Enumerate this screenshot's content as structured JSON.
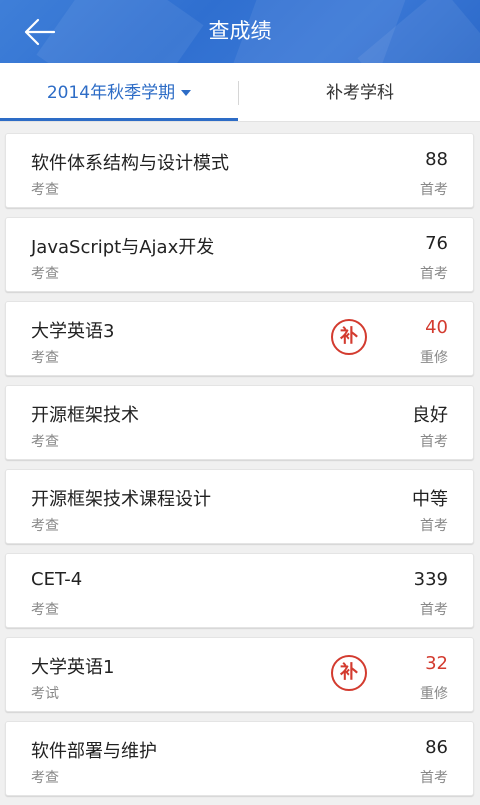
{
  "header": {
    "title": "查成绩"
  },
  "tabs": {
    "term": "2014年秋季学期",
    "makeup": "补考学科"
  },
  "stamp_text": "补",
  "accent_color": "#2d6cc6",
  "retake_color": "#d33b2f",
  "grades": [
    {
      "name": "软件体系结构与设计模式",
      "type": "考查",
      "score": "88",
      "exam": "首考",
      "makeup": false
    },
    {
      "name": "JavaScript与Ajax开发",
      "type": "考查",
      "score": "76",
      "exam": "首考",
      "makeup": false
    },
    {
      "name": "大学英语3",
      "type": "考查",
      "score": "40",
      "exam": "重修",
      "makeup": true
    },
    {
      "name": "开源框架技术",
      "type": "考查",
      "score": "良好",
      "exam": "首考",
      "makeup": false
    },
    {
      "name": "开源框架技术课程设计",
      "type": "考查",
      "score": "中等",
      "exam": "首考",
      "makeup": false
    },
    {
      "name": "CET-4",
      "type": "考查",
      "score": "339",
      "exam": "首考",
      "makeup": false
    },
    {
      "name": "大学英语1",
      "type": "考试",
      "score": "32",
      "exam": "重修",
      "makeup": true
    },
    {
      "name": "软件部署与维护",
      "type": "考查",
      "score": "86",
      "exam": "首考",
      "makeup": false
    }
  ]
}
